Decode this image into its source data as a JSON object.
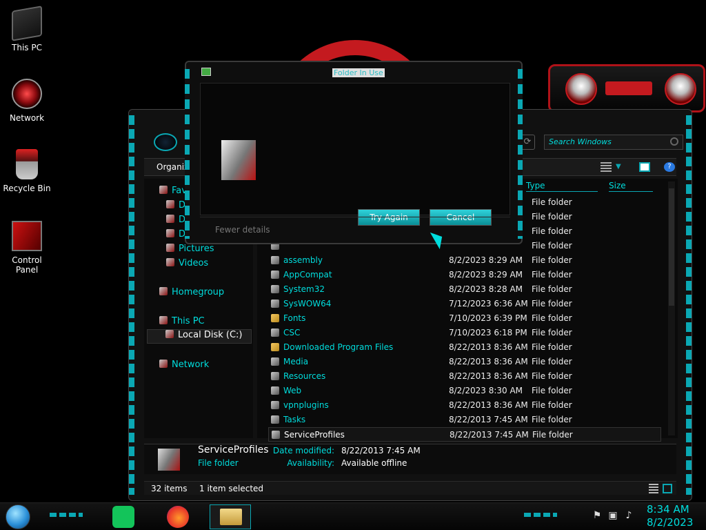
{
  "desktop": {
    "icons": [
      {
        "label": "This PC"
      },
      {
        "label": "Network"
      },
      {
        "label": "Recycle Bin"
      },
      {
        "label": "Control Panel"
      }
    ]
  },
  "explorer": {
    "search_placeholder": "Search Windows",
    "organize_label": "Organize",
    "columns": {
      "type": "Type",
      "size": "Size"
    },
    "nav": {
      "favorites": "Fav",
      "d1": "D",
      "d2": "D",
      "d3": "D",
      "pictures": "Pictures",
      "videos": "Videos",
      "homegroup": "Homegroup",
      "this_pc": "This PC",
      "local_disk": "Local Disk (C:)",
      "network": "Network"
    },
    "files": [
      {
        "name": "",
        "date": "",
        "type": "File folder"
      },
      {
        "name": "",
        "date": "",
        "type": "File folder"
      },
      {
        "name": "",
        "date": "",
        "type": "File folder"
      },
      {
        "name": "",
        "date": "",
        "type": "File folder"
      },
      {
        "name": "assembly",
        "date": "8/2/2023 8:29 AM",
        "type": "File folder"
      },
      {
        "name": "AppCompat",
        "date": "8/2/2023 8:29 AM",
        "type": "File folder"
      },
      {
        "name": "System32",
        "date": "8/2/2023 8:28 AM",
        "type": "File folder"
      },
      {
        "name": "SysWOW64",
        "date": "7/12/2023 6:36 AM",
        "type": "File folder"
      },
      {
        "name": "Fonts",
        "date": "7/10/2023 6:39 PM",
        "type": "File folder"
      },
      {
        "name": "CSC",
        "date": "7/10/2023 6:18 PM",
        "type": "File folder"
      },
      {
        "name": "Downloaded Program Files",
        "date": "8/22/2013 8:36 AM",
        "type": "File folder"
      },
      {
        "name": "Media",
        "date": "8/22/2013 8:36 AM",
        "type": "File folder"
      },
      {
        "name": "Resources",
        "date": "8/22/2013 8:36 AM",
        "type": "File folder"
      },
      {
        "name": "Web",
        "date": "8/2/2023 8:30 AM",
        "type": "File folder"
      },
      {
        "name": "vpnplugins",
        "date": "8/22/2013 8:36 AM",
        "type": "File folder"
      },
      {
        "name": "Tasks",
        "date": "8/22/2013 7:45 AM",
        "type": "File folder"
      },
      {
        "name": "ServiceProfiles",
        "date": "8/22/2013 7:45 AM",
        "type": "File folder"
      }
    ],
    "details": {
      "name": "ServiceProfiles",
      "type": "File folder",
      "date_label": "Date modified:",
      "date_value": "8/22/2013 7:45 AM",
      "avail_label": "Availability:",
      "avail_value": "Available offline"
    },
    "status": {
      "count": "32 items",
      "selected": "1 item selected"
    }
  },
  "dialog": {
    "title": "Folder In Use",
    "try_again": "Try Again",
    "cancel": "Cancel",
    "fewer_details": "Fewer details"
  },
  "taskbar": {
    "time": "8:34 AM",
    "date": "8/2/2023"
  },
  "colors": {
    "accent": "#0aa8b4",
    "brand_red": "#c41a1f",
    "text_cyan": "#00dddd"
  }
}
